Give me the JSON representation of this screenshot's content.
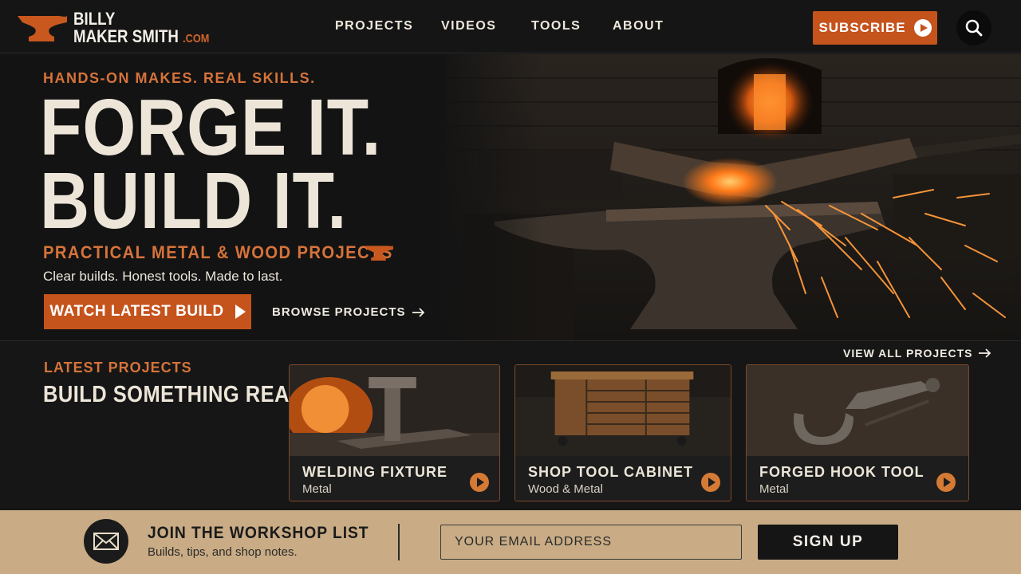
{
  "brand": {
    "line1": "BILLY",
    "line2": "MAKER SMITH",
    "tld": ".COM"
  },
  "nav": [
    {
      "label": "PROJECTS"
    },
    {
      "label": "VIDEOS"
    },
    {
      "label": "TOOLS"
    },
    {
      "label": "ABOUT"
    }
  ],
  "header": {
    "subscribe_label": "SUBSCRIBE"
  },
  "hero": {
    "tagline": "HANDS-ON MAKES. REAL SKILLS.",
    "headline_1": "FORGE IT.",
    "headline_2": "BUILD IT.",
    "subhead": "PRACTICAL METAL & WOOD PROJECTS",
    "description": "Clear builds. Honest tools. Made to last.",
    "watch_label": "WATCH LATEST BUILD",
    "browse_label": "BROWSE PROJECTS"
  },
  "projects": {
    "kicker": "LATEST PROJECTS",
    "title": "BUILD SOMETHING REAL",
    "view_all_label": "VIEW ALL PROJECTS",
    "cards": [
      {
        "title": "WELDING FIXTURE",
        "category": "Metal"
      },
      {
        "title": "SHOP TOOL CABINET",
        "category": "Wood & Metal"
      },
      {
        "title": "FORGED HOOK TOOL",
        "category": "Metal"
      }
    ]
  },
  "newsletter": {
    "title": "JOIN THE WORKSHOP LIST",
    "subtitle": "Builds, tips, and shop notes.",
    "email_placeholder": "YOUR EMAIL ADDRESS",
    "signup_label": "SIGN UP"
  },
  "colors": {
    "accent": "#c5531c",
    "accent_text": "#d6733a",
    "dark": "#141414",
    "newsletter_bg": "#c9ac85"
  },
  "icons": [
    "anvil-logo-icon",
    "play-icon",
    "search-icon",
    "arrow-right-icon",
    "mail-icon"
  ]
}
